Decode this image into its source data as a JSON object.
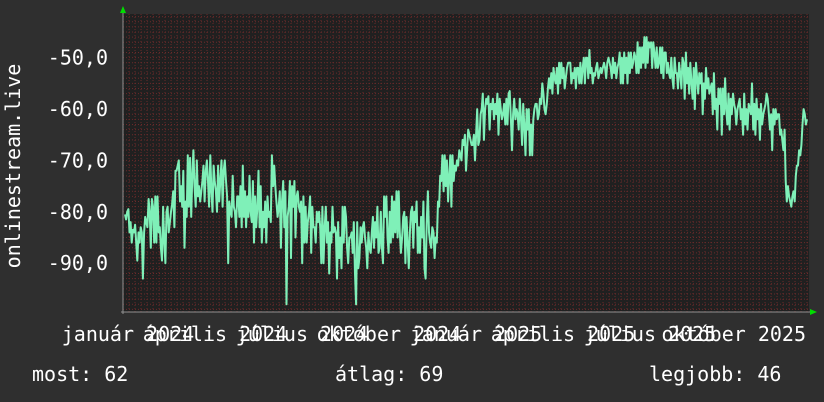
{
  "chart_data": {
    "type": "line",
    "ylabel": "onlinestream.live",
    "y_scale": "inverted",
    "ylim": [
      -99.5,
      -41.5
    ],
    "y_ticks": [
      -50,
      -60,
      -70,
      -80,
      -90
    ],
    "y_tick_labels": [
      "-50,0",
      "-60,0",
      "-70,0",
      "-80,0",
      "-90,0"
    ],
    "x_tick_labels": [
      "január 2024",
      "április 2024",
      "július 2024",
      "október 2024",
      "január 2025",
      "április 2025",
      "július 2025",
      "október 2025"
    ],
    "grid": true,
    "colors": {
      "background": "#2f2f2f",
      "plot_background": "#202020",
      "grid": "#6a2a2a",
      "line": "#7ff0b8",
      "axis_arrow": "#00dd00",
      "text": "#ffffff"
    },
    "series": [
      {
        "values": [
          -80.5,
          -81.5,
          -80,
          -79.5,
          -84,
          -82,
          -86,
          -83.5,
          -84,
          -82.5,
          -86,
          -89.5,
          -84,
          -86,
          -83,
          -84,
          -93,
          -84,
          -81,
          -82,
          -83,
          -77.5,
          -80,
          -87,
          -77.5,
          -79,
          -86,
          -77,
          -86,
          -77,
          -84,
          -83,
          -87,
          -89.5,
          -79,
          -86,
          -90,
          -80,
          -79,
          -84,
          -82,
          -80,
          -78.5,
          -76,
          -83,
          -72,
          -72,
          -71,
          -70,
          -78,
          -75,
          -79,
          -72,
          -87,
          -78,
          -81,
          -69,
          -79,
          -69.5,
          -81,
          -73,
          -68,
          -75,
          -79,
          -70,
          -77,
          -75,
          -78,
          -76,
          -74,
          -71,
          -78,
          -72,
          -70,
          -74,
          -79,
          -69,
          -76,
          -80,
          -71,
          -74,
          -76,
          -80,
          -71,
          -78,
          -74,
          -70,
          -79,
          -72,
          -70,
          -74,
          -77,
          -90,
          -78,
          -80,
          -81,
          -73,
          -79,
          -80,
          -83,
          -77,
          -77,
          -81,
          -75,
          -83,
          -71,
          -81,
          -76,
          -83,
          -77,
          -81,
          -73,
          -80,
          -82,
          -74,
          -86,
          -77,
          -83,
          -79,
          -72,
          -83,
          -75,
          -86,
          -80,
          -83,
          -78,
          -86,
          -77,
          -81,
          -80,
          -82,
          -69,
          -75,
          -71,
          -75,
          -78,
          -81,
          -79,
          -76,
          -87,
          -78,
          -74,
          -83,
          -76,
          -98,
          -81,
          -79,
          -74,
          -89,
          -75,
          -79,
          -74,
          -85,
          -77,
          -76,
          -79,
          -80,
          -78,
          -90,
          -77,
          -86,
          -79,
          -86,
          -82,
          -80,
          -77,
          -88,
          -79,
          -83,
          -83,
          -86,
          -80,
          -82,
          -80,
          -83,
          -90,
          -79,
          -90,
          -83,
          -79,
          -86,
          -82,
          -92,
          -84,
          -86,
          -79,
          -84,
          -83,
          -84,
          -93,
          -82,
          -89,
          -85,
          -91,
          -79,
          -86,
          -79,
          -81,
          -87,
          -90,
          -85,
          -85,
          -84,
          -88,
          -82,
          -92,
          -98,
          -82,
          -91,
          -89,
          -83,
          -86,
          -83,
          -82,
          -85,
          -87,
          -91,
          -84,
          -87,
          -88,
          -84,
          -81,
          -87,
          -82,
          -85,
          -79,
          -88,
          -87,
          -80,
          -87,
          -90,
          -77,
          -81,
          -77,
          -85,
          -88,
          -80,
          -86,
          -77,
          -85,
          -78,
          -84,
          -76,
          -85,
          -76,
          -84,
          -88,
          -85,
          -81,
          -80,
          -90,
          -81,
          -86,
          -91,
          -84,
          -80,
          -79,
          -87,
          -80,
          -82,
          -78,
          -88,
          -83,
          -88,
          -81,
          -85,
          -78,
          -91,
          -93,
          -82,
          -76,
          -84,
          -86,
          -87,
          -83,
          -84,
          -89,
          -85,
          -86,
          -78,
          -79,
          -73,
          -74,
          -69,
          -76,
          -69,
          -75,
          -70,
          -78,
          -73,
          -69,
          -79,
          -69,
          -74,
          -71,
          -72,
          -70,
          -71,
          -68,
          -69,
          -70,
          -66,
          -67,
          -65,
          -72,
          -68,
          -64,
          -65,
          -66,
          -67,
          -67,
          -65,
          -70,
          -65,
          -60,
          -67,
          -66,
          -61,
          -60,
          -57,
          -66,
          -60,
          -58,
          -59,
          -57.5,
          -64,
          -59,
          -60,
          -58,
          -62,
          -59,
          -61,
          -57,
          -65,
          -58,
          -60,
          -62,
          -61,
          -59,
          -63,
          -58,
          -63,
          -57,
          -56.5,
          -62,
          -68,
          -61,
          -58,
          -62,
          -60,
          -61,
          -64,
          -58,
          -62,
          -67,
          -59,
          -63,
          -69,
          -60,
          -64,
          -60,
          -69,
          -63,
          -69,
          -62,
          -60,
          -59,
          -59,
          -62,
          -61,
          -58,
          -59,
          -55,
          -57,
          -60,
          -61,
          -59,
          -56,
          -54,
          -56,
          -53,
          -57,
          -52,
          -54,
          -55,
          -52,
          -57,
          -51,
          -55,
          -51,
          -54,
          -52,
          -56,
          -54,
          -52,
          -51,
          -51,
          -51,
          -55,
          -53,
          -54,
          -52,
          -56,
          -52,
          -52,
          -55,
          -51,
          -55,
          -52,
          -50,
          -55,
          -50,
          -50,
          -54,
          -48.5,
          -53,
          -52,
          -55,
          -53,
          -53.5,
          -52,
          -51,
          -54,
          -53,
          -52,
          -53,
          -52,
          -51,
          -52,
          -54,
          -51,
          -50,
          -51,
          -52,
          -54,
          -50,
          -53,
          -51,
          -54,
          -52,
          -51,
          -49,
          -55,
          -50,
          -55,
          -49,
          -53,
          -50,
          -55,
          -49,
          -53,
          -49,
          -52,
          -51,
          -49,
          -50,
          -53,
          -47,
          -53,
          -48,
          -52,
          -48,
          -51,
          -46,
          -52,
          -46,
          -51,
          -47,
          -48,
          -47,
          -52,
          -47,
          -49,
          -52,
          -48,
          -52,
          -51,
          -48,
          -53,
          -48,
          -54,
          -49,
          -49,
          -53,
          -51,
          -53,
          -54,
          -50,
          -54,
          -56,
          -50,
          -53,
          -53,
          -56,
          -51,
          -53,
          -56,
          -50,
          -51,
          -58,
          -49,
          -55,
          -52,
          -57,
          -51,
          -55,
          -58,
          -52,
          -60,
          -51,
          -54,
          -57,
          -53,
          -55,
          -53,
          -61,
          -55,
          -58,
          -52,
          -56,
          -54,
          -57,
          -56,
          -55,
          -61,
          -53,
          -60,
          -58,
          -64,
          -56,
          -59,
          -56,
          -65,
          -56,
          -61,
          -54,
          -60,
          -63,
          -57,
          -64,
          -58,
          -61,
          -57,
          -59,
          -60,
          -63,
          -60,
          -59,
          -58,
          -62,
          -60,
          -65,
          -57,
          -63,
          -60,
          -64,
          -59,
          -60,
          -61,
          -55,
          -64,
          -59,
          -65,
          -58,
          -62,
          -60,
          -66,
          -59,
          -63,
          -61,
          -60,
          -59,
          -57,
          -58,
          -61,
          -64,
          -61,
          -68,
          -60,
          -63,
          -60,
          -62,
          -61,
          -61,
          -65,
          -64,
          -66,
          -68,
          -64,
          -74,
          -78,
          -75,
          -77,
          -78,
          -79,
          -77,
          -76,
          -78,
          -73,
          -71,
          -71,
          -68,
          -69,
          -67,
          -63,
          -60,
          -61,
          -63,
          -62
        ]
      }
    ]
  },
  "footer": {
    "current": "most: 62",
    "average": "átlag: 69",
    "best": "legjobb: 46"
  }
}
